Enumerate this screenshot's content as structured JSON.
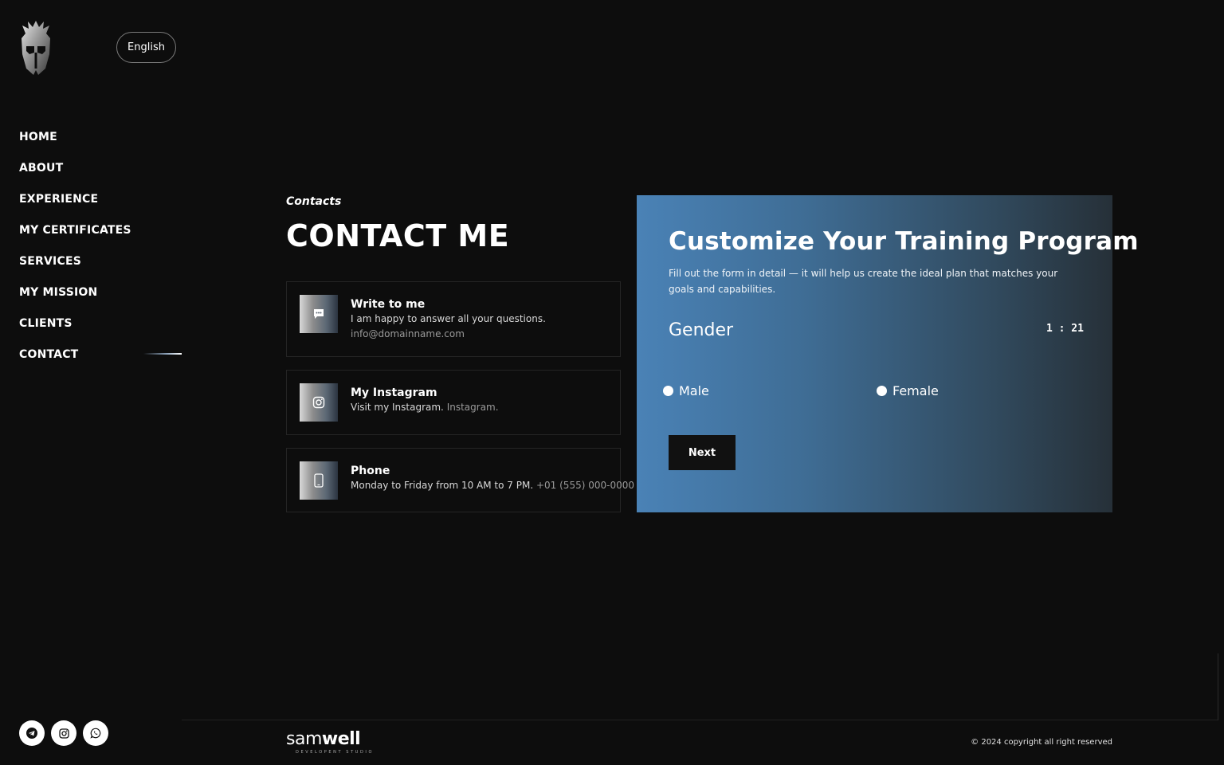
{
  "header": {
    "language": "English"
  },
  "nav": {
    "items": [
      {
        "label": "HOME"
      },
      {
        "label": "ABOUT"
      },
      {
        "label": "EXPERIENCE"
      },
      {
        "label": "MY CERTIFICATES"
      },
      {
        "label": "SERVICES"
      },
      {
        "label": "MY MISSION"
      },
      {
        "label": "CLIENTS"
      },
      {
        "label": "CONTACT"
      }
    ],
    "active": "CONTACT"
  },
  "section": {
    "eyebrow": "Contacts",
    "title": "CONTACT ME"
  },
  "contacts": [
    {
      "icon": "chat-icon",
      "title": "Write to me",
      "text": "I am happy to answer all your questions.",
      "value": "info@domainname.com"
    },
    {
      "icon": "instagram-icon",
      "title": "My Instagram",
      "text": "Visit my Instagram.",
      "value": "Instagram."
    },
    {
      "icon": "phone-icon",
      "title": "Phone",
      "text": "Monday to Friday from 10 AM to 7 PM.",
      "value": "+01 (555) 000-0000"
    }
  ],
  "form": {
    "title": "Customize Your Training Program",
    "description": "Fill out the form in detail — it will help us create the ideal plan that matches your goals and capabilities.",
    "question": "Gender",
    "timer": "1 : 21",
    "options": [
      {
        "label": "Male"
      },
      {
        "label": "Female"
      }
    ],
    "next_label": "Next"
  },
  "socials": [
    {
      "icon": "telegram-icon"
    },
    {
      "icon": "instagram-icon"
    },
    {
      "icon": "whatsapp-icon"
    }
  ],
  "footer": {
    "brand_light": "sam",
    "brand_bold": "well",
    "brand_sub": "DEVELOPENT STUDIO",
    "copyright": "© 2024 copyright all right reserved"
  },
  "colors": {
    "background": "#0d0d0d",
    "panel_gradient_start": "#4a82b6",
    "panel_gradient_end": "#263038",
    "button_dark": "#111111"
  }
}
